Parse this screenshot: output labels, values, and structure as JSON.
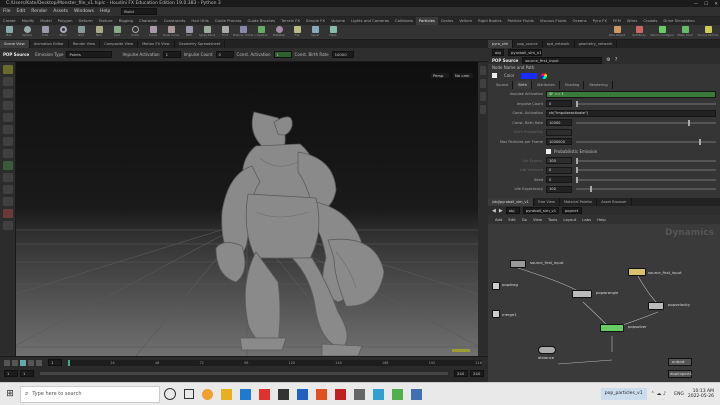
{
  "window": {
    "title": "C:/Users/Kate/Desktop/Monster_file_v1.hiplc - Houdini FX Education Edition 19.0.383 - Python 3"
  },
  "menu": {
    "items": [
      "File",
      "Edit",
      "Render",
      "Assets",
      "Windows",
      "Help"
    ],
    "build": "Build"
  },
  "shelf": {
    "tabs": [
      "Create",
      "Modify",
      "Model",
      "Polygon",
      "Deform",
      "Texture",
      "Rigging",
      "Character",
      "Constraints",
      "Hair Utils",
      "Guide Process",
      "Guide Brushes",
      "Terrain FX",
      "Simple FX",
      "Volume",
      "Lights and Cameras",
      "Collisions",
      "Particles",
      "Grains",
      "Vellum",
      "Rigid Bodies",
      "Particle Fluids",
      "Viscous Fluids",
      "Oceans",
      "Pyro FX",
      "FEM",
      "Wires",
      "Crowds",
      "Drive Simulation"
    ],
    "active_tab": "Particles",
    "tools": [
      "Box",
      "Sphere",
      "Tube",
      "Torus",
      "Grid",
      "Null",
      "Line",
      "Circle",
      "Curve",
      "Draw Curve",
      "Path",
      "Spray Paint",
      "Font",
      "Platonic Solids",
      "L-System",
      "Metaball",
      "File",
      "Spiral",
      "Helix"
    ],
    "right_tools": [
      "Wire Object",
      "Soft Body",
      "Vellum Configure",
      "Make Solid",
      "Source Particle"
    ]
  },
  "panes": {
    "left_tabs": [
      "Scene View",
      "Animation Editor",
      "Render View",
      "Composite View",
      "Motion FX View",
      "Geometry Spreadsheet"
    ],
    "active": "Scene View"
  },
  "viewport_toolbar": {
    "sop": "POP Source",
    "emission_type_label": "Emission Type",
    "emission_type": "Points",
    "impulse_label": "Impulse Activation",
    "impulse_val": "1",
    "impulse_count_label": "Impulse Count",
    "impulse_count": "0",
    "const_label": "Const. Activation",
    "const_val": "1",
    "birth_rate_label": "Const. Birth Rate",
    "birth_rate": "10000"
  },
  "viewport": {
    "persp": "Persp",
    "cam": "No cam"
  },
  "timeline": {
    "frame": "1",
    "start": "1",
    "end": "240",
    "end2": "240",
    "ticks": [
      "1",
      "24",
      "48",
      "72",
      "96",
      "120",
      "144",
      "168",
      "192",
      "216"
    ]
  },
  "params": {
    "tabs": [
      "pyro_sim",
      "pop_source",
      "spd_network",
      "geometry_network"
    ],
    "path": "obj",
    "node": "pyroball_sim_v1",
    "type": "POP Source",
    "name": "source_first_input",
    "group_label": "Node Name and Path",
    "source_tabs": [
      "Source",
      "Birth",
      "Attributes",
      "Shading",
      "Rendering"
    ],
    "active_source_tab": "Birth",
    "rows": [
      {
        "label": "Impulse Activation",
        "value": "$F == 1"
      },
      {
        "label": "Impulse Count",
        "value": "0"
      },
      {
        "label": "Const. Activation",
        "value": "ch(\"impulseactivate\")"
      },
      {
        "label": "Const. Birth Rate",
        "value": "10000"
      },
      {
        "label": "Birth Probability",
        "value": ""
      },
      {
        "label": "Max Particles per Frame",
        "value": "1000000"
      },
      {
        "label": "",
        "value": "Probabilistic Emission"
      },
      {
        "label": "Life Expect.",
        "value": "100"
      },
      {
        "label": "Life Variance",
        "value": "0"
      },
      {
        "label": "Seed",
        "value": "0"
      },
      {
        "label": "Life Expectancy",
        "value": "100"
      }
    ],
    "color_label": "Color"
  },
  "network": {
    "tabs": [
      "/obj/pyroball_sim_v1",
      "Tree View",
      "Material Palette",
      "Asset Browser"
    ],
    "path_root": "obj",
    "path_node": "pyroball_sim_v1",
    "path_leaf": "popnet",
    "menu": [
      "Add",
      "Edit",
      "Go",
      "View",
      "Tools",
      "Layout",
      "Labs",
      "Help"
    ],
    "context": "Dynamics",
    "nodes": [
      "source_first_input",
      "popwrangle",
      "popvelocity",
      "popdrag",
      "popsolver",
      "merge1",
      "distance",
      "output",
      "dopimport1"
    ]
  },
  "taskbar": {
    "search": "Type here to search",
    "app": "pop_particles_v1",
    "lang": "ENG",
    "time": "10:13 AM",
    "date": "2022-05-26"
  }
}
